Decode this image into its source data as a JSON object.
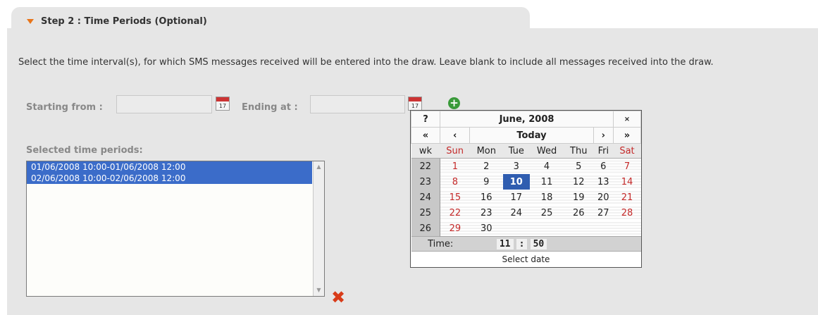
{
  "step_title": "Step 2 : Time Periods (Optional)",
  "description": "Select the time interval(s), for which SMS messages received will be entered into the draw. Leave blank to include all messages received into the draw.",
  "form": {
    "start_label": "Starting from :",
    "start_value": "",
    "end_label": "Ending at :",
    "end_value": "",
    "calendar_icon_text": "17"
  },
  "selected": {
    "label": "Selected time periods:",
    "items": [
      "01/06/2008 10:00-01/06/2008 12:00",
      "02/06/2008 10:00-02/06/2008 12:00"
    ]
  },
  "calendar": {
    "help": "?",
    "title": "June, 2008",
    "close": "×",
    "prev_year": "«",
    "prev_month": "‹",
    "today": "Today",
    "next_month": "›",
    "next_year": "»",
    "wk_label": "wk",
    "day_names": [
      "Sun",
      "Mon",
      "Tue",
      "Wed",
      "Thu",
      "Fri",
      "Sat"
    ],
    "weeks": [
      {
        "wk": "22",
        "days": [
          "1",
          "2",
          "3",
          "4",
          "5",
          "6",
          "7"
        ]
      },
      {
        "wk": "23",
        "days": [
          "8",
          "9",
          "10",
          "11",
          "12",
          "13",
          "14"
        ]
      },
      {
        "wk": "24",
        "days": [
          "15",
          "16",
          "17",
          "18",
          "19",
          "20",
          "21"
        ]
      },
      {
        "wk": "25",
        "days": [
          "22",
          "23",
          "24",
          "25",
          "26",
          "27",
          "28"
        ]
      },
      {
        "wk": "26",
        "days": [
          "29",
          "30",
          "",
          "",
          "",
          "",
          ""
        ]
      }
    ],
    "selected_day": "10",
    "time_label": "Time:",
    "hour": "11",
    "minute": "50",
    "status": "Select date"
  },
  "colors": {
    "accent": "#e8751a",
    "selection": "#3b6cc9",
    "weekend": "#c52a2a",
    "add": "#3a9a3a",
    "delete": "#d83c1a"
  }
}
